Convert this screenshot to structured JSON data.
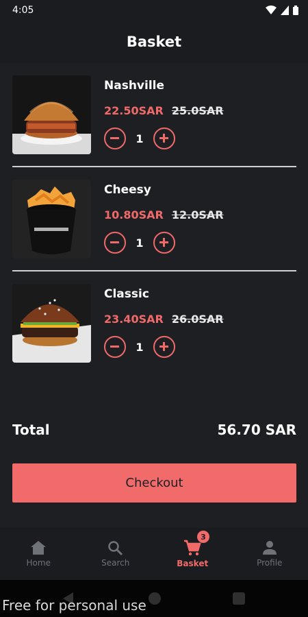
{
  "status_bar": {
    "time": "4:05"
  },
  "header": {
    "title": "Basket"
  },
  "items": [
    {
      "name": "Nashville",
      "price": "22.50SAR",
      "old_price": "25.0SAR",
      "qty": "1"
    },
    {
      "name": "Cheesy",
      "price": "10.80SAR",
      "old_price": "12.0SAR",
      "qty": "1"
    },
    {
      "name": "Classic",
      "price": "23.40SAR",
      "old_price": "26.0SAR",
      "qty": "1"
    }
  ],
  "total": {
    "label": "Total",
    "value": "56.70 SAR"
  },
  "checkout": {
    "label": "Checkout"
  },
  "nav": {
    "items": [
      {
        "label": "Home",
        "icon": "home-icon"
      },
      {
        "label": "Search",
        "icon": "search-icon"
      },
      {
        "label": "Basket",
        "icon": "cart-icon",
        "badge": "3",
        "active": true
      },
      {
        "label": "Profile",
        "icon": "person-icon"
      }
    ]
  },
  "watermark": "Free for personal use",
  "colors": {
    "accent": "#f06a6a",
    "background": "#1e1f23",
    "bar": "#1b1c20"
  }
}
